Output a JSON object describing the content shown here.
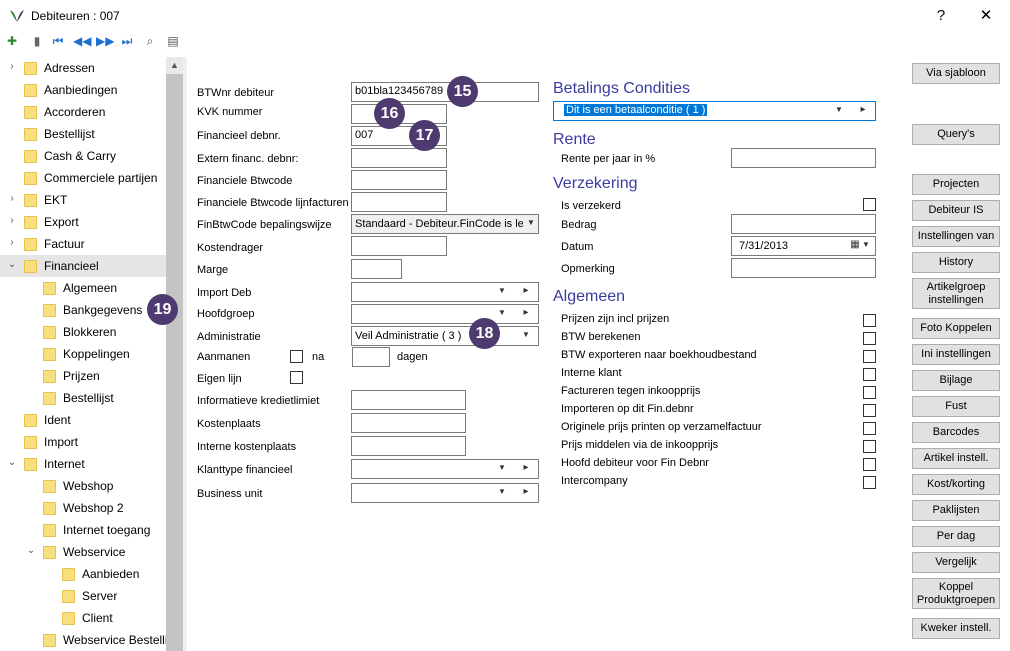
{
  "window": {
    "title": "Debiteuren : 007",
    "help": "?",
    "close": "✕"
  },
  "tree": [
    {
      "label": "Adressen",
      "expander": "›"
    },
    {
      "label": "Aanbiedingen",
      "expander": ""
    },
    {
      "label": "Accorderen",
      "expander": ""
    },
    {
      "label": "Bestellijst",
      "expander": ""
    },
    {
      "label": "Cash & Carry",
      "expander": ""
    },
    {
      "label": "Commerciele partijen",
      "expander": ""
    },
    {
      "label": "EKT",
      "expander": "›"
    },
    {
      "label": "Export",
      "expander": "›"
    },
    {
      "label": "Factuur",
      "expander": "›"
    },
    {
      "label": "Financieel",
      "expander": "⌄"
    },
    {
      "label": "Algemeen",
      "expander": ""
    },
    {
      "label": "Bankgegevens",
      "expander": ""
    },
    {
      "label": "Blokkeren",
      "expander": ""
    },
    {
      "label": "Koppelingen",
      "expander": ""
    },
    {
      "label": "Prijzen",
      "expander": ""
    },
    {
      "label": "Bestellijst",
      "expander": ""
    },
    {
      "label": "Ident",
      "expander": ""
    },
    {
      "label": "Import",
      "expander": ""
    },
    {
      "label": "Internet",
      "expander": "⌄"
    },
    {
      "label": "Webshop",
      "expander": ""
    },
    {
      "label": "Webshop 2",
      "expander": ""
    },
    {
      "label": "Internet toegang",
      "expander": ""
    },
    {
      "label": "Webservice",
      "expander": "⌄"
    },
    {
      "label": "Aanbieden",
      "expander": ""
    },
    {
      "label": "Server",
      "expander": ""
    },
    {
      "label": "Client",
      "expander": ""
    },
    {
      "label": "Webservice Bestellij",
      "expander": ""
    }
  ],
  "form": {
    "btwnr_label": "BTWnr debiteur",
    "btwnr_value": "b01bla123456789",
    "kvk_label": "KVK nummer",
    "kvk_value": "",
    "fin_debnr_label": "Financieel debnr.",
    "fin_debnr_value": "007",
    "extern_label": "Extern financ. debnr:",
    "fin_btw_label": "Financiele Btwcode",
    "fin_btw_lijn_label": "Financiele Btwcode lijnfacturen",
    "finbtw_bep_label": "FinBtwCode bepalingswijze",
    "finbtw_bep_value": "Standaard - Debiteur.FinCode is leid",
    "kostendrager_label": "Kostendrager",
    "marge_label": "Marge",
    "import_deb_label": "Import Deb",
    "hoofdgroep_label": "Hoofdgroep",
    "administratie_label": "Administratie",
    "administratie_value": "Veil Administratie  ( 3 )",
    "aanmanen_label": "Aanmanen",
    "aanmanen_na": "na",
    "aanmanen_dagen": "dagen",
    "eigen_lijn_label": "Eigen lijn",
    "kredietlimiet_label": "Informatieve kredietlimiet",
    "kostenplaats_label": "Kostenplaats",
    "interne_kp_label": "Interne kostenplaats",
    "klanttype_label": "Klanttype financieel",
    "business_unit_label": "Business unit"
  },
  "badges": {
    "b15": "15",
    "b16": "16",
    "b17": "17",
    "b18": "18",
    "b19": "19"
  },
  "right": {
    "betalings_title": "Betalings Condities",
    "betalings_value": "Dit is een betaalconditie  ( 1 )",
    "rente_title": "Rente",
    "rente_label": "Rente per jaar in %",
    "verzekering_title": "Verzekering",
    "is_verzekerd_label": "Is verzekerd",
    "bedrag_label": "Bedrag",
    "datum_label": "Datum",
    "datum_value": "7/31/2013",
    "opmerking_label": "Opmerking",
    "algemeen_title": "Algemeen",
    "checks": [
      "Prijzen zijn incl prijzen",
      "BTW berekenen",
      "BTW exporteren naar boekhoudbestand",
      "Interne klant",
      "Factureren tegen inkoopprijs",
      "Importeren op dit Fin.debnr",
      "Originele prijs printen op verzamelfactuur",
      "Prijs middelen via de inkoopprijs",
      "Hoofd debiteur voor Fin Debnr",
      "Intercompany"
    ]
  },
  "buttons": {
    "via_sjabloon": "Via sjabloon",
    "querys": "Query's",
    "projecten": "Projecten",
    "debiteur_is": "Debiteur IS",
    "instellingen_van": "Instellingen van",
    "history": "History",
    "artikelgroep": "Artikelgroep instellingen",
    "foto_koppelen": "Foto Koppelen",
    "ini_instellingen": "Ini instellingen",
    "bijlage": "Bijlage",
    "fust": "Fust",
    "barcodes": "Barcodes",
    "artikel_instell": "Artikel instell.",
    "kost_korting": "Kost/korting",
    "paklijsten": "Paklijsten",
    "per_dag": "Per dag",
    "vergelijk": "Vergelijk",
    "koppel_produkt": "Koppel Produktgroepen",
    "kweker_instell": "Kweker instell."
  },
  "colors": {
    "section": "#3c3ca0",
    "badge": "#4e3a6e",
    "selection": "#0078d7"
  }
}
